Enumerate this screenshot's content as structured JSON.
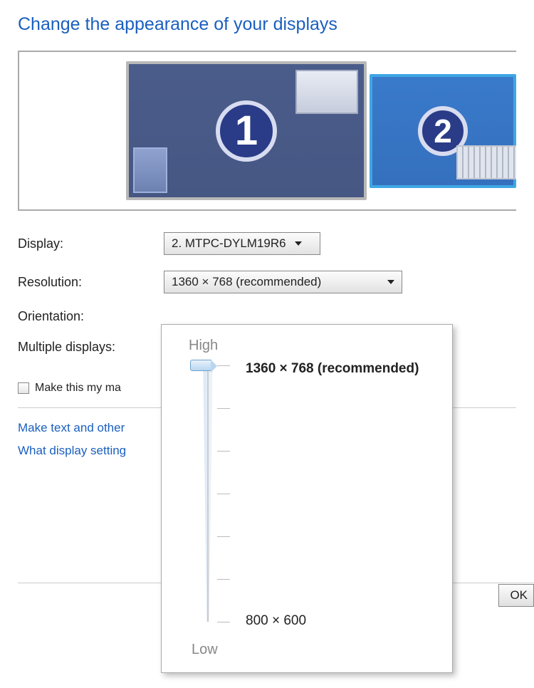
{
  "title": "Change the appearance of your displays",
  "monitors": [
    "1",
    "2"
  ],
  "labels": {
    "display": "Display:",
    "resolution": "Resolution:",
    "orientation": "Orientation:",
    "multiple": "Multiple displays:"
  },
  "display_dropdown": "2. MTPC-DYLM19R6",
  "resolution_dropdown": "1360 × 768 (recommended)",
  "make_main_checkbox": "Make this my ma",
  "links": {
    "text_size": "Make text and other",
    "settings_q": "What display setting"
  },
  "ok_button": "OK",
  "slider": {
    "high": "High",
    "low": "Low",
    "top_value": "1360 × 768 (recommended)",
    "bottom_value": "800 × 600"
  }
}
